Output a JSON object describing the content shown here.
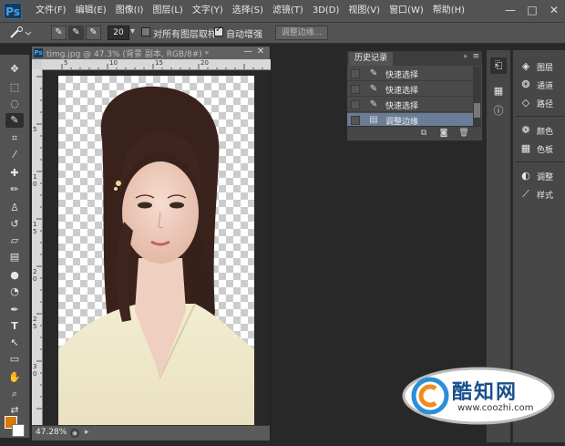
{
  "app": {
    "logo": "Ps"
  },
  "menu": [
    "文件(F)",
    "编辑(E)",
    "图像(I)",
    "图层(L)",
    "文字(Y)",
    "选择(S)",
    "滤镜(T)",
    "3D(D)",
    "视图(V)",
    "窗口(W)",
    "帮助(H)"
  ],
  "window_controls": {
    "minimize": "—",
    "maximize": "□",
    "close": "✕"
  },
  "options": {
    "brush_size": "20",
    "sample_all_layers": "对所有图层取样",
    "sample_all_layers_checked": false,
    "auto_enhance": "自动增强",
    "auto_enhance_checked": true,
    "refine_edge": "调整边缘..."
  },
  "document": {
    "title": "timg.jpg @ 47.3% (背景 副本, RGB/8#) *",
    "zoom": "47.28%",
    "ruler_h": [
      "5",
      "10",
      "15",
      "20"
    ],
    "ruler_v": [
      "5",
      "1\n0",
      "1\n5",
      "2\n0",
      "2\n5",
      "3\n0"
    ]
  },
  "history": {
    "tab": "历史记录",
    "items": [
      {
        "label": "快速选择",
        "selected": false
      },
      {
        "label": "快速选择",
        "selected": false
      },
      {
        "label": "快速选择",
        "selected": false
      },
      {
        "label": "调整边缘",
        "selected": true
      }
    ]
  },
  "dock": {
    "panels": [
      {
        "label": "图层",
        "icon": "layers-icon"
      },
      {
        "label": "通道",
        "icon": "channels-icon"
      },
      {
        "label": "路径",
        "icon": "paths-icon"
      },
      {
        "label": "颜色",
        "icon": "color-icon"
      },
      {
        "label": "色板",
        "icon": "swatches-icon"
      },
      {
        "label": "调整",
        "icon": "adjustments-icon"
      },
      {
        "label": "样式",
        "icon": "styles-icon"
      }
    ]
  },
  "colors": {
    "foreground": "#d67a00",
    "background": "#ffffff",
    "selected_row": "#6a7c96"
  },
  "watermark": {
    "name": "酷知网",
    "url": "www.coozhi.com"
  }
}
